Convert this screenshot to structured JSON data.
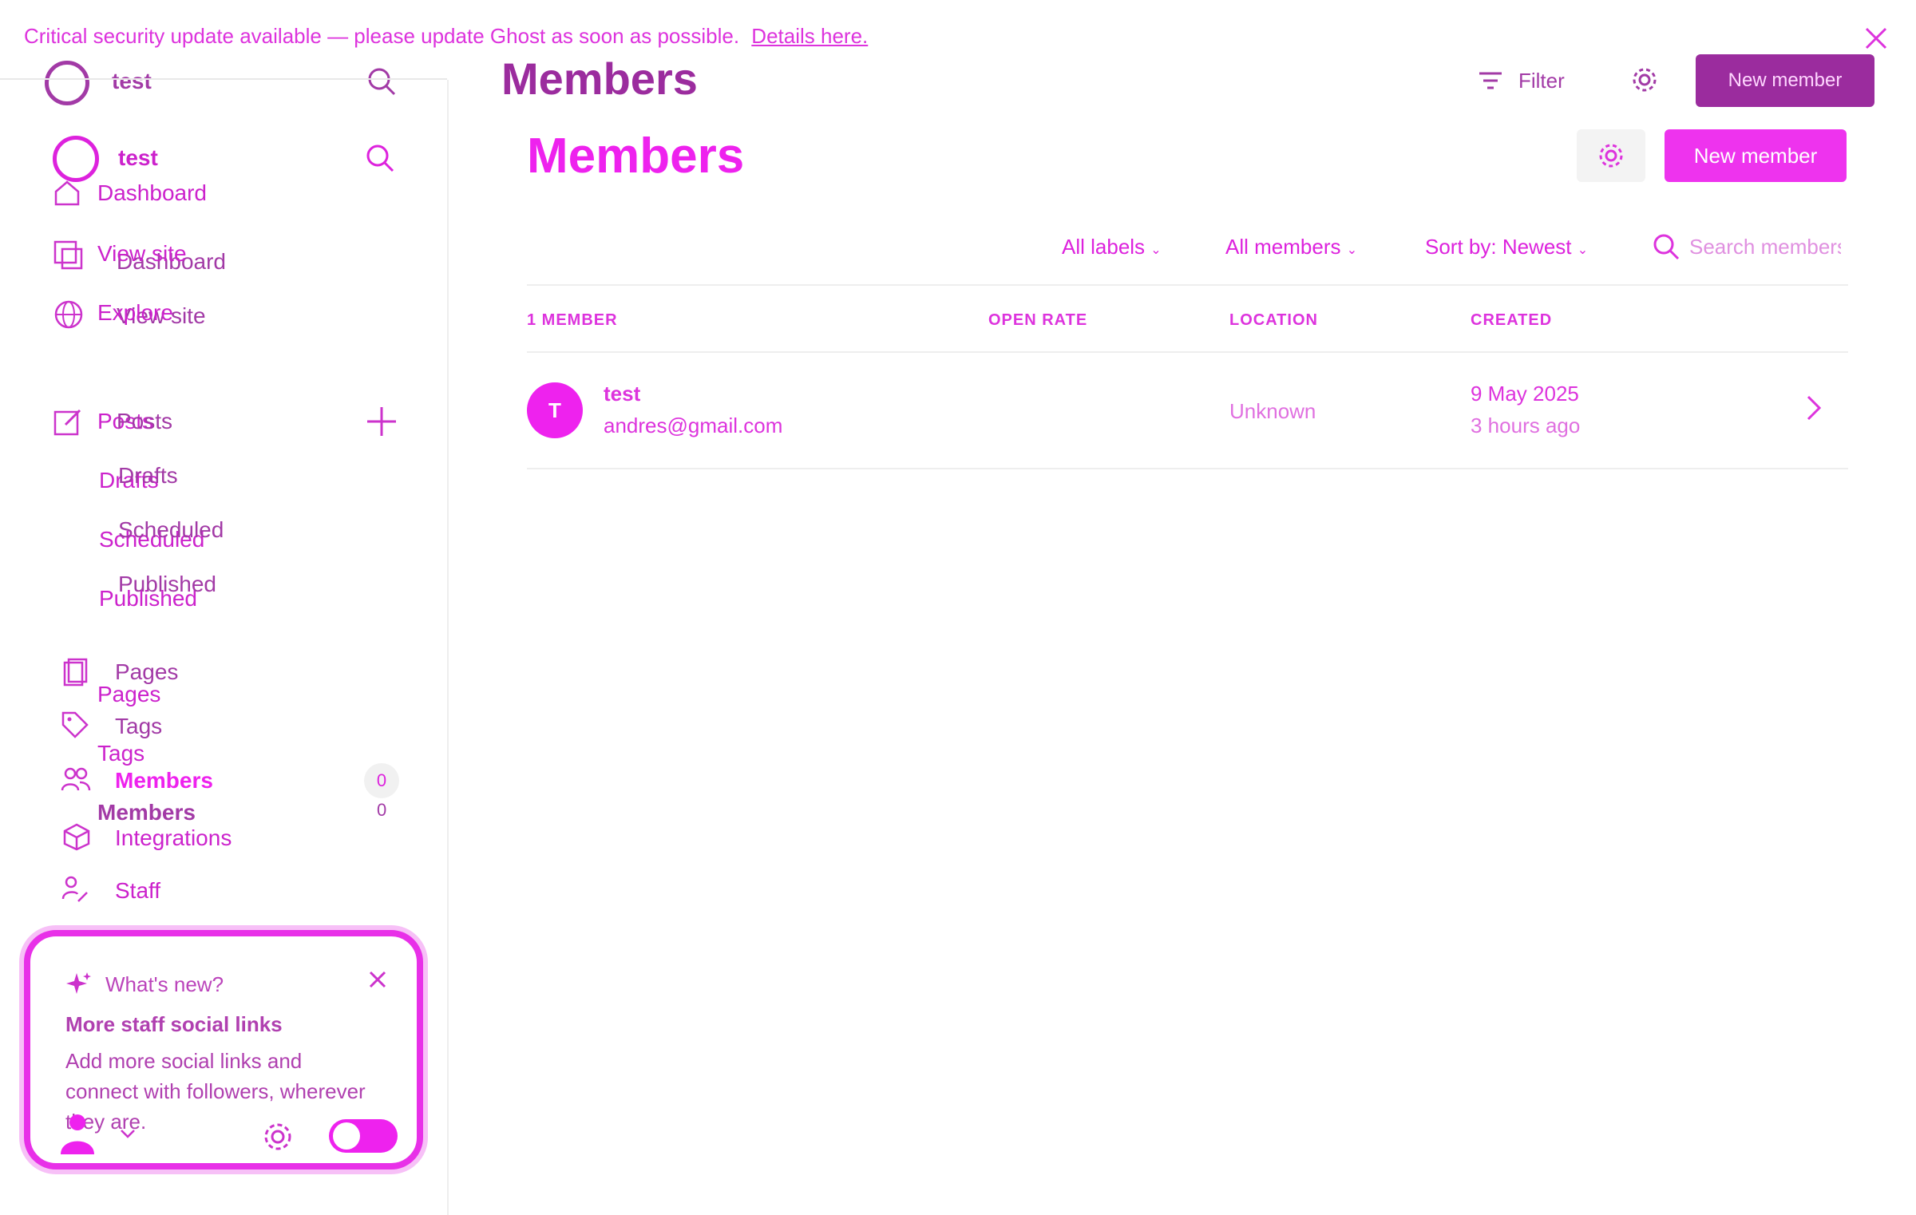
{
  "banner": {
    "text": "Critical security update available — please update Ghost as soon as possible.",
    "link": "Details here."
  },
  "header_ghost": {
    "site": "test",
    "title": "Members",
    "filter": "Filter",
    "new_member": "New member"
  },
  "sidebar": {
    "site": "test",
    "items": {
      "dashboard": "Dashboard",
      "view_site": "View site",
      "explore": "Explore",
      "posts": "Posts",
      "drafts": "Drafts",
      "scheduled": "Scheduled",
      "published": "Published",
      "pages": "Pages",
      "tags": "Tags",
      "members": "Members",
      "members_count": "0",
      "integrations": "Integrations",
      "staff": "Staff"
    },
    "ghost_items": {
      "dashboard": "Dashboard",
      "view_site": "View site",
      "posts": "Posts",
      "drafts": "Drafts",
      "scheduled": "Scheduled",
      "published": "Published",
      "pages": "Pages",
      "tags": "Tags",
      "members": "Members",
      "members_count": "0"
    },
    "whats_new": {
      "label": "What's new?",
      "heading": "More staff social links",
      "body": "Add more social links and connect with followers, wherever they are."
    }
  },
  "main": {
    "title": "Members",
    "new_member": "New member",
    "filters": {
      "labels": "All labels",
      "members": "All members",
      "sort": "Sort by: Newest",
      "search_placeholder": "Search members..."
    },
    "table": {
      "headers": [
        "1 MEMBER",
        "OPEN RATE",
        "LOCATION",
        "CREATED"
      ],
      "rows": [
        {
          "initial": "T",
          "name": "test",
          "email": "andres@gmail.com",
          "location": "Unknown",
          "created": "9 May 2025",
          "created_ago": "3 hours ago"
        }
      ]
    }
  },
  "colors": {
    "accent": "#ee22ee",
    "ghost": "#9b2c9e"
  }
}
